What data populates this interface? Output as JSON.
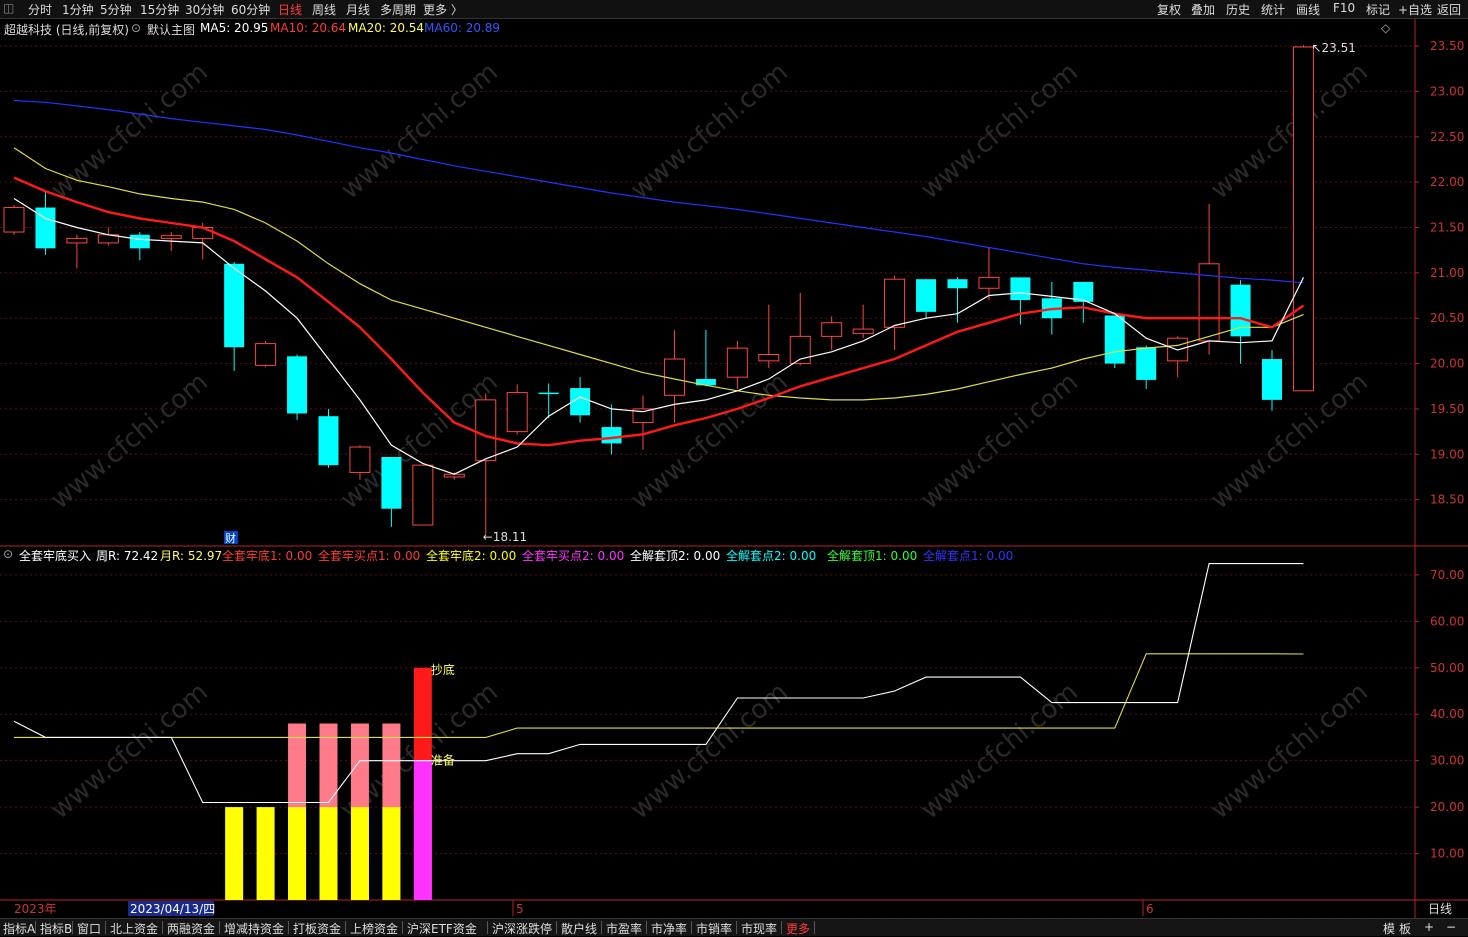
{
  "toolbar": {
    "left_items": [
      "分时",
      "1分钟",
      "5分钟",
      "15分钟",
      "30分钟",
      "60分钟",
      "日线",
      "周线",
      "月线",
      "多周期",
      "更多 〉"
    ],
    "active": "日线",
    "right_items": [
      "复权",
      "叠加",
      "历史",
      "统计",
      "画线",
      "F10",
      "标记",
      "+自选",
      "返回"
    ]
  },
  "main_header": {
    "stock": "超越科技 (日线,前复权)",
    "template": "默认主图",
    "ma5": "MA5: 20.95",
    "ma10": "MA10: 20.64",
    "ma20": "MA20: 20.54",
    "ma60": "MA60: 20.89"
  },
  "main_axis_ticks": [
    "23.50",
    "23.00",
    "22.50",
    "22.00",
    "21.50",
    "21.00",
    "20.50",
    "20.00",
    "19.50",
    "19.00",
    "18.50"
  ],
  "annotations": {
    "high": "23.51",
    "low": "18.11",
    "cai": "财"
  },
  "sub_header": {
    "indicator": "全套牢底买入",
    "week_r": "周R: 72.42",
    "month_r": "月R: 52.97",
    "items": [
      {
        "text": "全套牢底1: 0.00",
        "color": "#ff3b3b"
      },
      {
        "text": "全套牢买点1: 0.00",
        "color": "#ff3b3b"
      },
      {
        "text": "全套牢底2: 0.00",
        "color": "#ffff00"
      },
      {
        "text": "全套牢买点2: 0.00",
        "color": "#ff33ff"
      },
      {
        "text": "全解套顶2: 0.00",
        "color": "#ffffff"
      },
      {
        "text": "全解套点2: 0.00",
        "color": "#00ffff"
      },
      {
        "text": "全解套顶1: 0.00",
        "color": "#33ff33"
      },
      {
        "text": "全解套点1: 0.00",
        "color": "#3333ff"
      }
    ]
  },
  "sub_axis_ticks": [
    "70.00",
    "60.00",
    "50.00",
    "40.00",
    "30.00",
    "20.00",
    "10.00"
  ],
  "sub_labels": {
    "chaodi": "抄底",
    "zhunbei": "准备"
  },
  "date_bar": {
    "year": "2023年",
    "cursor_date": "2023/04/13/四",
    "m5": "5",
    "m6": "6",
    "period": "日线"
  },
  "bottom_tabs": [
    "指标A",
    "指标B",
    "窗口",
    "北上资金",
    "两融资金",
    "增减持资金",
    "打板资金",
    "上榜资金",
    "沪深ETF资金",
    "沪深涨跌停",
    "散户线",
    "市盈率",
    "市净率",
    "市销率",
    "市现率",
    "更多"
  ],
  "bottom_right": [
    "模",
    "板",
    "+",
    "−"
  ],
  "chart_data": {
    "type": "candlestick",
    "candles": [
      {
        "o": 21.45,
        "h": 21.75,
        "l": 21.42,
        "c": 21.72
      },
      {
        "o": 21.72,
        "h": 21.9,
        "l": 21.2,
        "c": 21.27
      },
      {
        "o": 21.33,
        "h": 21.42,
        "l": 21.05,
        "c": 21.38
      },
      {
        "o": 21.33,
        "h": 21.5,
        "l": 21.3,
        "c": 21.42
      },
      {
        "o": 21.42,
        "h": 21.45,
        "l": 21.14,
        "c": 21.27
      },
      {
        "o": 21.38,
        "h": 21.45,
        "l": 21.24,
        "c": 21.41
      },
      {
        "o": 21.38,
        "h": 21.55,
        "l": 21.15,
        "c": 21.5
      },
      {
        "o": 21.1,
        "h": 21.12,
        "l": 19.92,
        "c": 20.18
      },
      {
        "o": 19.98,
        "h": 20.25,
        "l": 19.96,
        "c": 20.22
      },
      {
        "o": 20.08,
        "h": 20.1,
        "l": 19.38,
        "c": 19.45
      },
      {
        "o": 19.42,
        "h": 19.5,
        "l": 18.85,
        "c": 18.88
      },
      {
        "o": 18.8,
        "h": 19.1,
        "l": 18.72,
        "c": 19.08
      },
      {
        "o": 18.97,
        "h": 18.97,
        "l": 18.2,
        "c": 18.4
      },
      {
        "o": 18.22,
        "h": 18.88,
        "l": 18.22,
        "c": 18.88
      },
      {
        "o": 18.75,
        "h": 18.8,
        "l": 18.72,
        "c": 18.78
      },
      {
        "o": 18.93,
        "h": 19.67,
        "l": 18.11,
        "c": 19.6
      },
      {
        "o": 19.25,
        "h": 19.77,
        "l": 19.22,
        "c": 19.68
      },
      {
        "o": 19.68,
        "h": 19.78,
        "l": 19.4,
        "c": 19.67
      },
      {
        "o": 19.73,
        "h": 19.85,
        "l": 19.35,
        "c": 19.43
      },
      {
        "o": 19.3,
        "h": 19.55,
        "l": 19.0,
        "c": 19.12
      },
      {
        "o": 19.35,
        "h": 19.65,
        "l": 19.05,
        "c": 19.5
      },
      {
        "o": 19.65,
        "h": 20.37,
        "l": 19.35,
        "c": 20.05
      },
      {
        "o": 19.83,
        "h": 20.37,
        "l": 19.75,
        "c": 19.76
      },
      {
        "o": 19.85,
        "h": 20.25,
        "l": 19.72,
        "c": 20.17
      },
      {
        "o": 20.03,
        "h": 20.65,
        "l": 19.95,
        "c": 20.1
      },
      {
        "o": 20.0,
        "h": 20.78,
        "l": 19.98,
        "c": 20.3
      },
      {
        "o": 20.3,
        "h": 20.52,
        "l": 20.15,
        "c": 20.45
      },
      {
        "o": 20.33,
        "h": 20.65,
        "l": 20.28,
        "c": 20.38
      },
      {
        "o": 20.4,
        "h": 20.97,
        "l": 20.15,
        "c": 20.93
      },
      {
        "o": 20.93,
        "h": 20.93,
        "l": 20.5,
        "c": 20.57
      },
      {
        "o": 20.93,
        "h": 20.95,
        "l": 20.45,
        "c": 20.83
      },
      {
        "o": 20.83,
        "h": 21.28,
        "l": 20.7,
        "c": 20.95
      },
      {
        "o": 20.95,
        "h": 20.95,
        "l": 20.43,
        "c": 20.7
      },
      {
        "o": 20.72,
        "h": 20.9,
        "l": 20.32,
        "c": 20.5
      },
      {
        "o": 20.9,
        "h": 20.9,
        "l": 20.45,
        "c": 20.68
      },
      {
        "o": 20.53,
        "h": 20.53,
        "l": 19.95,
        "c": 20.0
      },
      {
        "o": 20.18,
        "h": 20.2,
        "l": 19.72,
        "c": 19.82
      },
      {
        "o": 20.03,
        "h": 20.3,
        "l": 19.85,
        "c": 20.28
      },
      {
        "o": 20.25,
        "h": 21.76,
        "l": 20.1,
        "c": 21.1
      },
      {
        "o": 20.87,
        "h": 20.92,
        "l": 20.0,
        "c": 20.3
      },
      {
        "o": 20.05,
        "h": 20.15,
        "l": 19.48,
        "c": 19.6
      },
      {
        "o": 19.7,
        "h": 23.51,
        "l": 19.7,
        "c": 23.49
      }
    ],
    "ma5": [
      21.82,
      21.6,
      21.5,
      21.42,
      21.37,
      21.35,
      21.33,
      21.05,
      20.8,
      20.5,
      20.05,
      19.6,
      19.1,
      18.9,
      18.78,
      18.95,
      19.08,
      19.42,
      19.63,
      19.5,
      19.47,
      19.55,
      19.6,
      19.7,
      19.83,
      20.05,
      20.13,
      20.25,
      20.42,
      20.5,
      20.55,
      20.75,
      20.78,
      20.74,
      20.7,
      20.55,
      20.28,
      20.15,
      20.25,
      20.23,
      20.25,
      20.95
    ],
    "ma10": [
      22.05,
      21.9,
      21.78,
      21.67,
      21.6,
      21.55,
      21.5,
      21.35,
      21.15,
      20.95,
      20.68,
      20.4,
      20.05,
      19.68,
      19.35,
      19.2,
      19.12,
      19.1,
      19.15,
      19.18,
      19.22,
      19.32,
      19.4,
      19.5,
      19.62,
      19.75,
      19.85,
      19.95,
      20.05,
      20.2,
      20.35,
      20.45,
      20.55,
      20.6,
      20.62,
      20.55,
      20.5,
      20.5,
      20.5,
      20.5,
      20.4,
      20.64
    ],
    "ma20": [
      22.38,
      22.15,
      22.02,
      21.95,
      21.87,
      21.82,
      21.78,
      21.7,
      21.55,
      21.35,
      21.1,
      20.88,
      20.7,
      20.6,
      20.5,
      20.4,
      20.3,
      20.2,
      20.1,
      20.0,
      19.9,
      19.83,
      19.76,
      19.7,
      19.65,
      19.62,
      19.6,
      19.6,
      19.62,
      19.66,
      19.72,
      19.8,
      19.88,
      19.95,
      20.05,
      20.13,
      20.17,
      20.2,
      20.3,
      20.4,
      20.4,
      20.54
    ],
    "ma60": [
      22.9,
      22.88,
      22.84,
      22.8,
      22.75,
      22.7,
      22.66,
      22.62,
      22.58,
      22.52,
      22.45,
      22.38,
      22.32,
      22.25,
      22.18,
      22.12,
      22.06,
      22.0,
      21.94,
      21.88,
      21.83,
      21.78,
      21.74,
      21.7,
      21.65,
      21.6,
      21.55,
      21.5,
      21.45,
      21.4,
      21.34,
      21.28,
      21.22,
      21.16,
      21.1,
      21.06,
      21.03,
      21.0,
      20.97,
      20.94,
      20.92,
      20.89
    ],
    "price_ylim": [
      18.0,
      23.6
    ],
    "sub_white": [
      38.5,
      35,
      35,
      35,
      35,
      35,
      21,
      21,
      21,
      21,
      21,
      30,
      30,
      30,
      30,
      30,
      31.5,
      31.5,
      33.5,
      33.5,
      33.5,
      33.5,
      33.5,
      43.5,
      43.5,
      43.5,
      43.5,
      43.5,
      45,
      48,
      48,
      48,
      48,
      42.5,
      42.5,
      42.5,
      42.5,
      42.5,
      72.42,
      72.42,
      72.42,
      72.42
    ],
    "sub_yellow": [
      35,
      35,
      35,
      35,
      35,
      35,
      35,
      35,
      35,
      35,
      35,
      35,
      35,
      35,
      35,
      35,
      37,
      37,
      37,
      37,
      37,
      37,
      37,
      37,
      37,
      37,
      37,
      37,
      37,
      37,
      37,
      37,
      37,
      37,
      37,
      37,
      53,
      53,
      53,
      53,
      53,
      52.97
    ],
    "sub_bars": [
      {
        "i": 7,
        "yellow": 20,
        "pink": 0,
        "red": 0,
        "magenta": 0
      },
      {
        "i": 8,
        "yellow": 20,
        "pink": 0,
        "red": 0,
        "magenta": 0
      },
      {
        "i": 9,
        "yellow": 20,
        "pink": 38,
        "red": 0,
        "magenta": 0
      },
      {
        "i": 10,
        "yellow": 20,
        "pink": 38,
        "red": 0,
        "magenta": 0
      },
      {
        "i": 11,
        "yellow": 20,
        "pink": 38,
        "red": 0,
        "magenta": 0
      },
      {
        "i": 12,
        "yellow": 20,
        "pink": 38,
        "red": 0,
        "magenta": 0
      },
      {
        "i": 13,
        "yellow": 0,
        "pink": 0,
        "red": 50,
        "magenta": 30
      }
    ],
    "sub_ylim": [
      0,
      76
    ]
  }
}
